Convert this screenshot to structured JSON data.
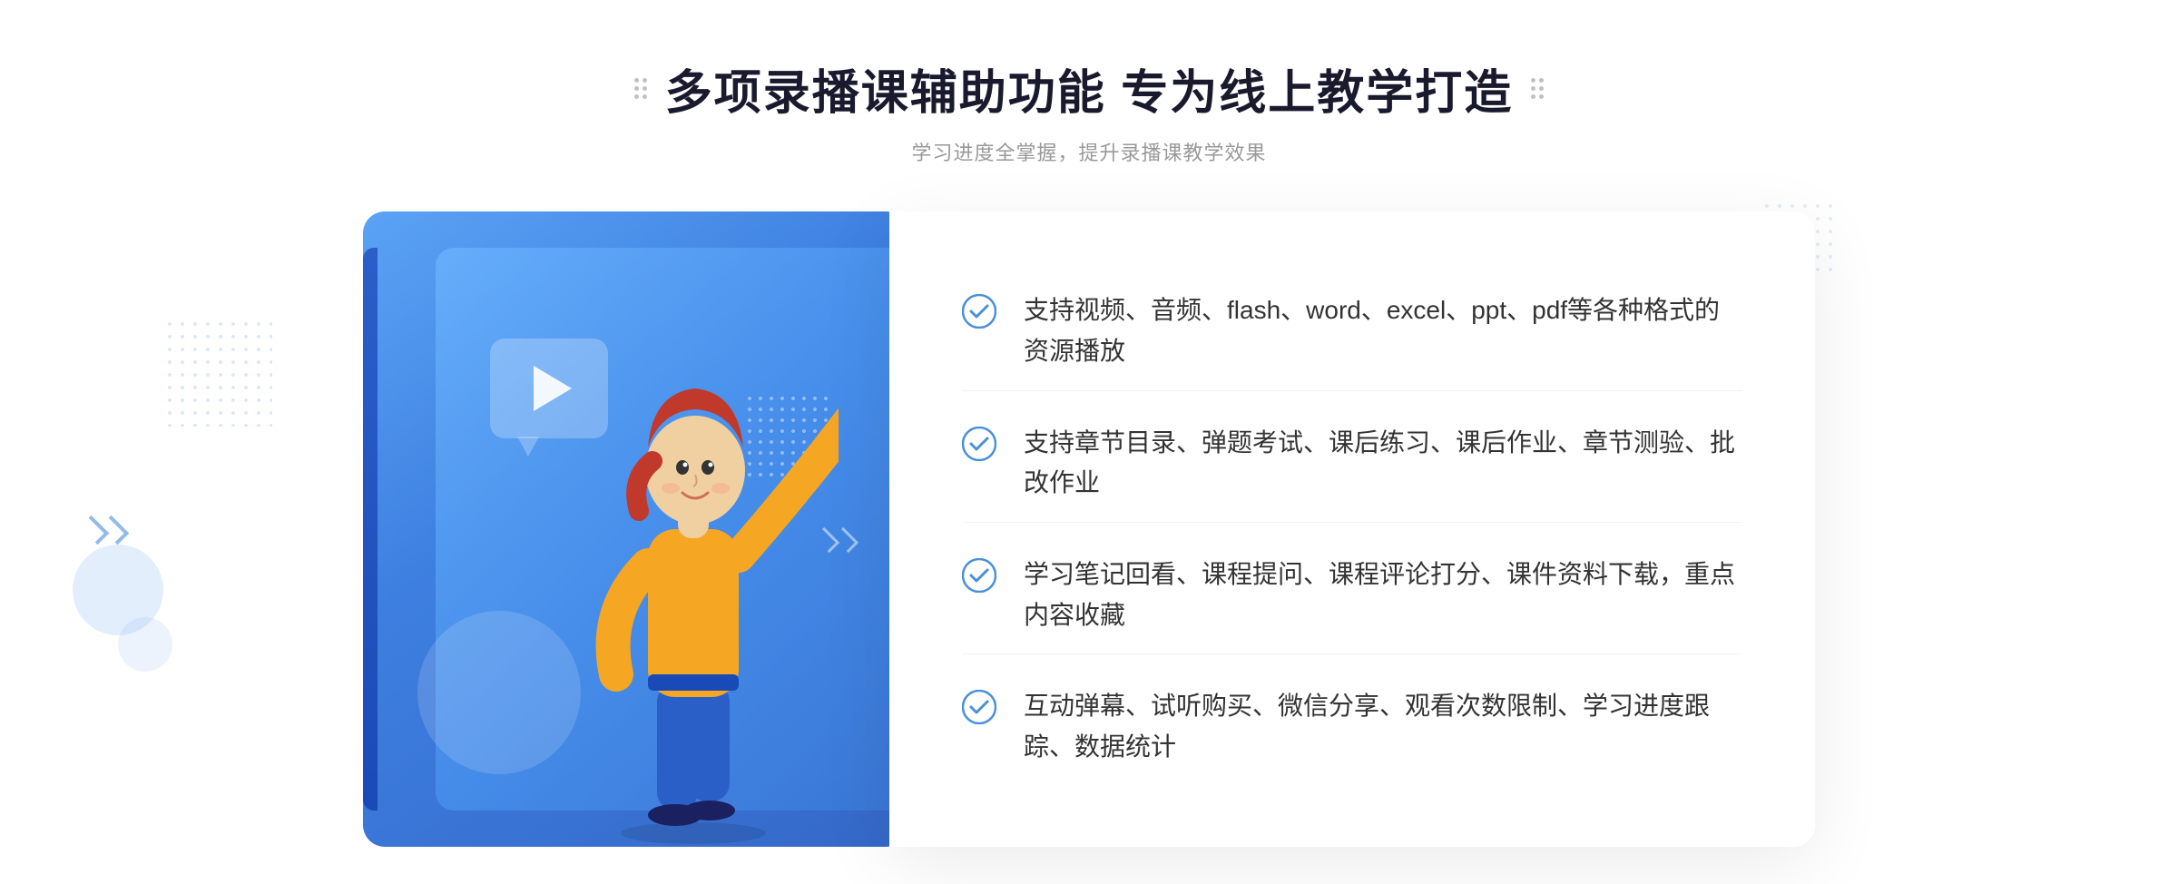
{
  "header": {
    "title": "多项录播课辅助功能 专为线上教学打造",
    "subtitle": "学习进度全掌握，提升录播课教学效果"
  },
  "features": [
    {
      "id": "feature-1",
      "text": "支持视频、音频、flash、word、excel、ppt、pdf等各种格式的资源播放"
    },
    {
      "id": "feature-2",
      "text": "支持章节目录、弹题考试、课后练习、课后作业、章节测验、批改作业"
    },
    {
      "id": "feature-3",
      "text": "学习笔记回看、课程提问、课程评论打分、课件资料下载，重点内容收藏"
    },
    {
      "id": "feature-4",
      "text": "互动弹幕、试听购买、微信分享、观看次数限制、学习进度跟踪、数据统计"
    }
  ],
  "decorative": {
    "dots_title": true,
    "play_button": true
  }
}
